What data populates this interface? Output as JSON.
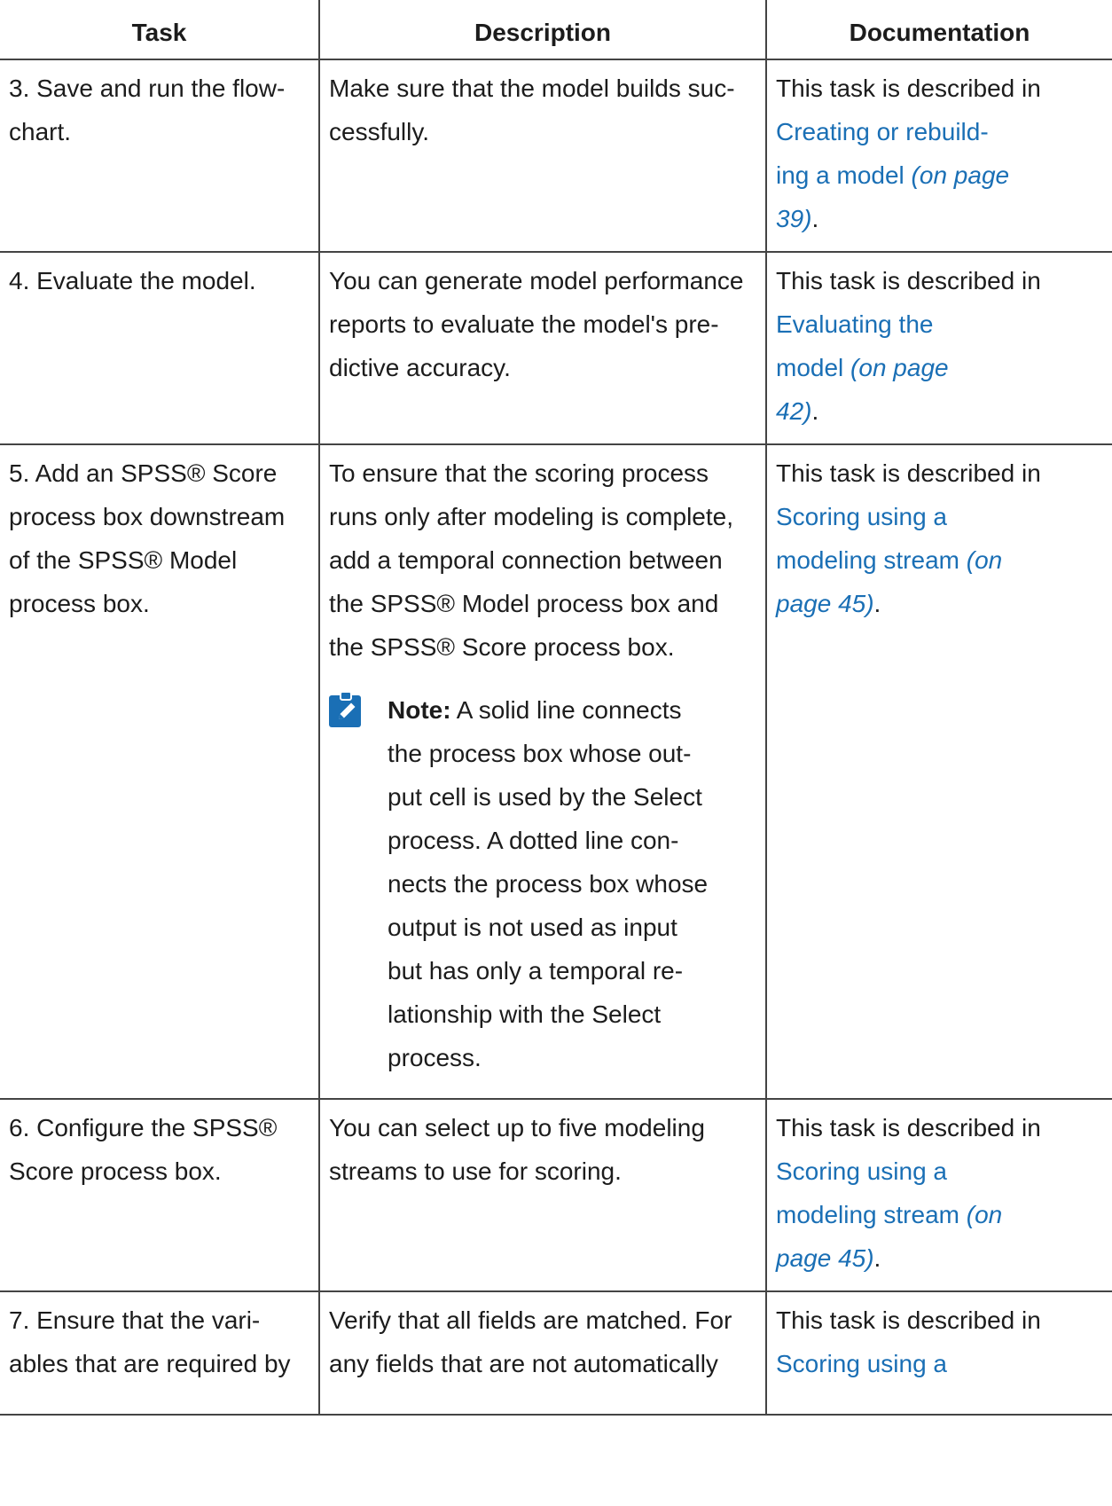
{
  "headers": {
    "task": "Task",
    "description": "Description",
    "documentation": "Documentation"
  },
  "rows": [
    {
      "task": "3. Save and run the flow-chart.",
      "description": "Make sure that the model builds suc-cessfully.",
      "doc_prefix": "This task is described in",
      "doc_link": "Creating or rebuild-ing a model",
      "doc_page": "(on page 39)",
      "doc_suffix": "."
    },
    {
      "task": "4. Evaluate the model.",
      "description": "You can generate model performance reports to evaluate the model's pre-dictive accuracy.",
      "doc_prefix": "This task is described in",
      "doc_link": "Evaluating the model",
      "doc_page": "(on page 42)",
      "doc_suffix": "."
    },
    {
      "task": "5. Add an SPSS® Score process box downstream of the SPSS® Model process box.",
      "description": "To ensure that the scoring process runs only after modeling is complete, add a temporal connection between the SPSS® Model process box and the SPSS® Score process box.",
      "note_label": "Note:",
      "note_text": "A solid line connects the process box whose out-put cell is used by the Select process. A dotted line con-nects the process box whose output is not used as input but has only a temporal re-lationship with the Select process.",
      "note_icon": "pencil-note-icon",
      "doc_prefix": "This task is described in",
      "doc_link": "Scoring using a modeling stream",
      "doc_page": "(on page 45)",
      "doc_suffix": "."
    },
    {
      "task": "6. Configure the SPSS® Score process box.",
      "description": "You can select up to five modeling streams to use for scoring.",
      "doc_prefix": "This task is described in",
      "doc_link": "Scoring using a modeling stream",
      "doc_page": "(on page 45)",
      "doc_suffix": "."
    },
    {
      "task": "7. Ensure that the vari-ables that are required by",
      "description": "Verify that all fields are matched. For any fields that are not automatically",
      "doc_prefix": "This task is described in",
      "doc_link": "Scoring using a"
    }
  ],
  "colors": {
    "link": "#1a6fb5",
    "note_icon_bg": "#1a6fb5",
    "border": "#444444"
  }
}
